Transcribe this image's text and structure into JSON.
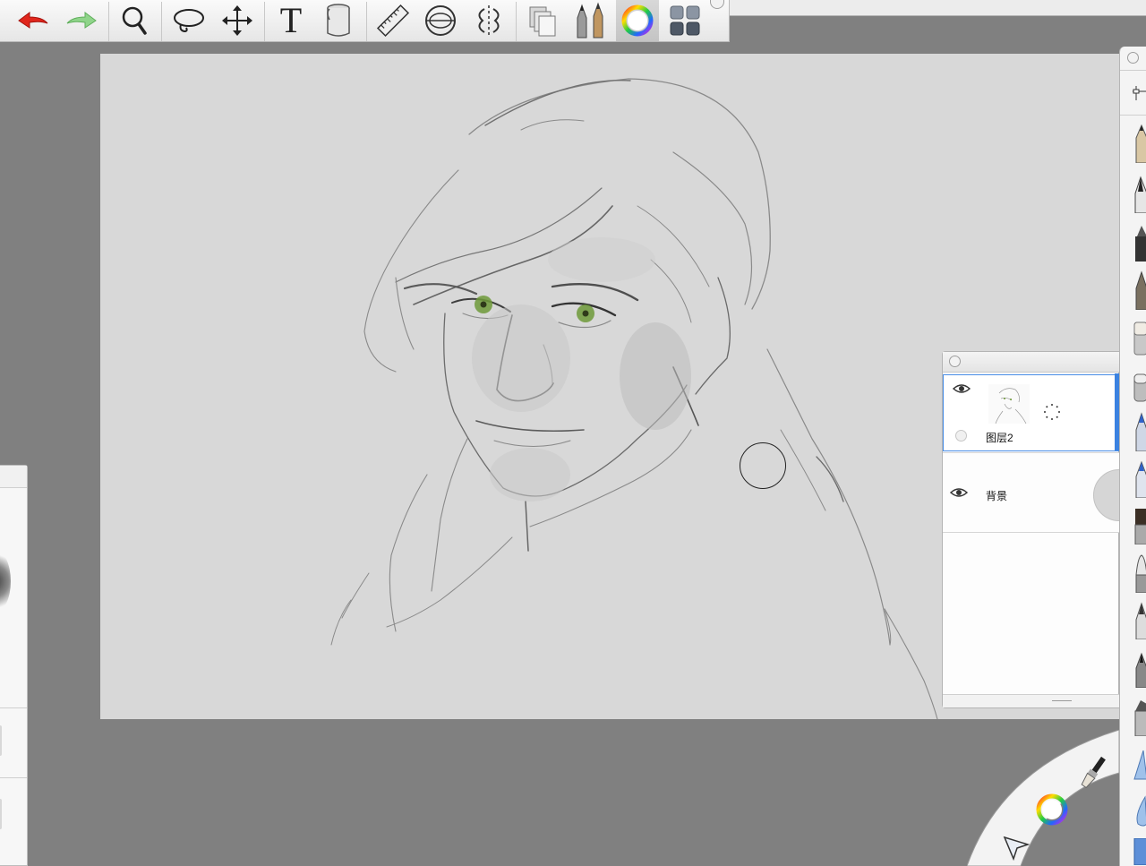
{
  "toolbar": {
    "tools": [
      {
        "id": "undo",
        "icon": "undo-arrow-icon",
        "color": "#e0261c"
      },
      {
        "id": "redo",
        "icon": "redo-arrow-icon",
        "color": "#7fce7a"
      },
      {
        "id": "zoom",
        "icon": "magnifier-icon"
      },
      {
        "id": "lasso",
        "icon": "lasso-icon"
      },
      {
        "id": "transform",
        "icon": "move-arrows-icon"
      },
      {
        "id": "text",
        "icon": "text-icon"
      },
      {
        "id": "fill",
        "icon": "paint-bucket-icon"
      },
      {
        "id": "ruler",
        "icon": "ruler-icon"
      },
      {
        "id": "ellipse-guide",
        "icon": "ellipse-guide-icon"
      },
      {
        "id": "symmetry",
        "icon": "symmetry-icon"
      },
      {
        "id": "copy-paste",
        "icon": "copy-paste-icon"
      },
      {
        "id": "brush-library",
        "icon": "pencils-icon"
      },
      {
        "id": "color-editor",
        "icon": "color-wheel-icon"
      },
      {
        "id": "ui-layout",
        "icon": "four-squares-icon"
      }
    ],
    "text_tool_glyph": "T"
  },
  "layers": {
    "items": [
      {
        "name": "图层2",
        "visible": true,
        "selected": true
      },
      {
        "name": "背景",
        "visible": true,
        "selected": false
      }
    ]
  },
  "lagoon": {
    "icons": [
      "paintbrush-icon",
      "color-wheel-icon",
      "select-arrow-icon"
    ]
  },
  "brush_palette": {
    "icons": [
      "sliders-icon",
      "pencil-icon",
      "ink-pen-icon",
      "marker-icon",
      "airbrush-icon",
      "eraser-icon",
      "smudge-icon",
      "blue-marker-icon",
      "blue-pen-icon",
      "paintbrush-flat-icon",
      "paintbrush-round-icon",
      "brush-fan-icon",
      "fineliner-icon",
      "chisel-marker-icon",
      "blue-triangle-icon",
      "blue-drop-icon",
      "blue-tab-icon"
    ]
  },
  "colors": {
    "background": "#808080",
    "canvas": "#d8d8d8",
    "selection_blue": "#3b82e0",
    "eye_green": "#6f9a3a"
  }
}
